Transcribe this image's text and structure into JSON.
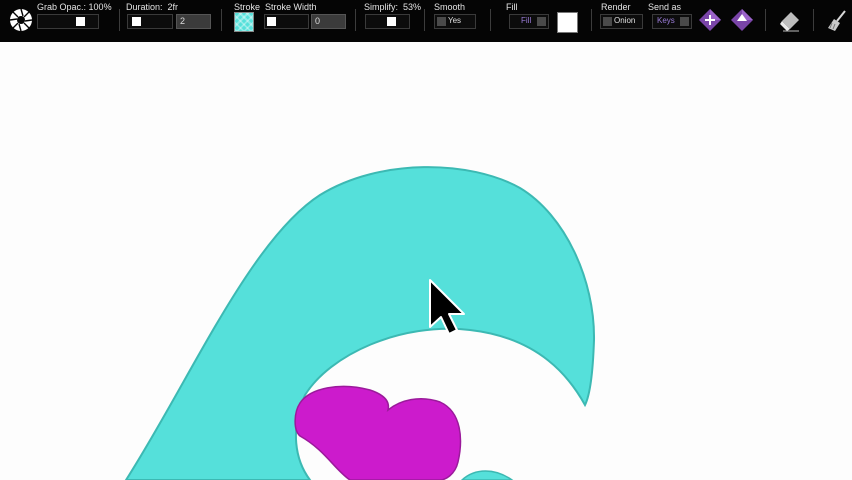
{
  "toolbar": {
    "grab_opacity": {
      "label": "Grab Opac.:",
      "value": "100%"
    },
    "duration": {
      "label": "Duration:",
      "value": "2fr",
      "input_value": "2"
    },
    "stroke": {
      "label": "Stroke",
      "color": "#55e0da"
    },
    "stroke_width": {
      "label": "Stroke Width",
      "input_value": "0"
    },
    "simplify": {
      "label": "Simplify:",
      "value": "53%"
    },
    "smooth": {
      "label": "Smooth",
      "option": "Yes"
    },
    "fill": {
      "label": "Fill",
      "button": "Fill",
      "color": "#ffffff"
    },
    "render": {
      "label": "Render",
      "option": "Onion"
    },
    "send_as": {
      "label": "Send as",
      "option": "Keys"
    }
  },
  "canvas": {
    "background": "#fdfdfd",
    "shapes": [
      {
        "name": "teal-wave-shape",
        "fill": "#55e0da",
        "stroke": "#3cb9b3"
      },
      {
        "name": "magenta-blob-shape",
        "fill": "#cc1bcc",
        "stroke": "#9b1a9b"
      }
    ],
    "cursor": "arrow-cursor-icon"
  }
}
